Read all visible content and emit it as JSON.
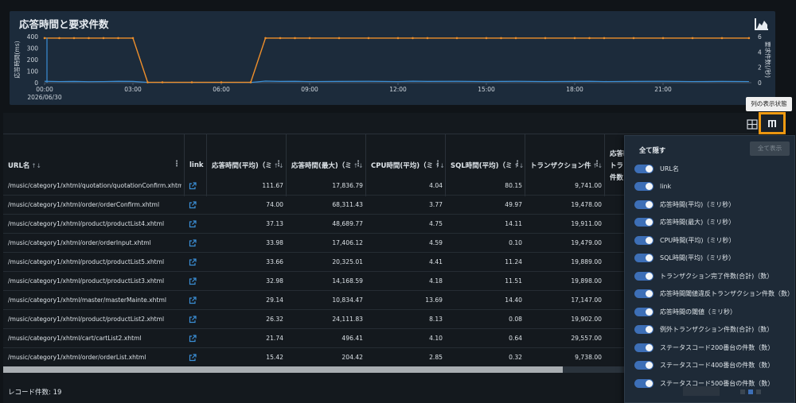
{
  "chart": {
    "title": "応答時間と要求件数",
    "icon": "area-chart-icon",
    "ylabel_left": "応答時間(ms)",
    "ylabel_right": "要求件数(/秒)",
    "y_left_ticks": [
      "400",
      "300",
      "200",
      "100",
      "0"
    ],
    "y_right_ticks": [
      "6",
      "4",
      "2",
      "0"
    ],
    "x_ticks": [
      "00:00",
      "03:00",
      "06:00",
      "09:00",
      "12:00",
      "15:00",
      "18:00",
      "21:00"
    ],
    "x_date": "2026/06/30",
    "colors": {
      "response": "#3b8fd6",
      "requests": "#ef8f2b"
    }
  },
  "chart_data": {
    "type": "line",
    "x": [
      "00:00",
      "00:30",
      "01:00",
      "01:30",
      "02:00",
      "02:30",
      "03:00",
      "03:30",
      "04:00",
      "05:00",
      "06:00",
      "07:00",
      "07:30",
      "08:00",
      "08:30",
      "09:00",
      "10:00",
      "11:00",
      "12:00",
      "12:30",
      "13:00",
      "14:00",
      "15:00",
      "15:30",
      "16:00",
      "17:00",
      "18:00",
      "18:30",
      "19:00",
      "20:00",
      "21:00",
      "22:00",
      "23:00",
      "23:55"
    ],
    "series": [
      {
        "values": [
          12,
          10,
          11,
          9,
          10,
          12,
          11,
          3,
          2,
          2,
          2,
          2,
          14,
          11,
          12,
          10,
          11,
          12,
          10,
          13,
          11,
          12,
          10,
          11,
          12,
          10,
          11,
          12,
          10,
          11,
          12,
          10,
          11,
          10
        ]
      },
      {
        "values": [
          5.8,
          5.8,
          5.8,
          5.8,
          5.8,
          5.8,
          5.8,
          0.05,
          0.05,
          0.05,
          0.05,
          0.05,
          5.8,
          5.8,
          5.8,
          5.8,
          5.8,
          5.8,
          5.8,
          5.8,
          5.8,
          5.8,
          5.8,
          5.8,
          5.8,
          5.8,
          5.8,
          5.8,
          5.8,
          5.8,
          5.8,
          5.8,
          5.8,
          5.8
        ]
      }
    ],
    "ylim_left": [
      0,
      400
    ],
    "ylim_right": [
      0,
      6
    ],
    "xlim": [
      "00:00",
      "24:00"
    ]
  },
  "grid": {
    "columns": [
      {
        "label": "URL名",
        "sort": "↑↓"
      },
      {
        "label": "link",
        "sort": ""
      },
      {
        "label": "応答時間(平均)（ミ",
        "sort": "↑↓"
      },
      {
        "label": "応答時間(最大)（ミ",
        "sort": "↑↓"
      },
      {
        "label": "CPU時間(平均)（ミ",
        "sort": "↑↓"
      },
      {
        "label": "SQL時間(平均)（ミ",
        "sort": "↑↓"
      },
      {
        "label": "トランザクション件",
        "sort": "↑↓"
      },
      {
        "label": "応答時",
        "sort": ""
      }
    ],
    "extra_header": [
      "トラ",
      "件数"
    ],
    "rows": [
      {
        "url": "/music/category1/xhtml/quotation/quotationConfirm.xhtml",
        "avg": "111.67",
        "max": "17,836.79",
        "cpu": "4.04",
        "sql": "80.15",
        "tx": "9,741.00"
      },
      {
        "url": "/music/category1/xhtml/order/orderConfirm.xhtml",
        "avg": "74.00",
        "max": "68,311.43",
        "cpu": "3.77",
        "sql": "49.97",
        "tx": "19,478.00"
      },
      {
        "url": "/music/category1/xhtml/product/productList4.xhtml",
        "avg": "37.13",
        "max": "48,689.77",
        "cpu": "4.75",
        "sql": "14.11",
        "tx": "19,911.00"
      },
      {
        "url": "/music/category1/xhtml/order/orderInput.xhtml",
        "avg": "33.98",
        "max": "17,406.12",
        "cpu": "4.59",
        "sql": "0.10",
        "tx": "19,479.00"
      },
      {
        "url": "/music/category1/xhtml/product/productList5.xhtml",
        "avg": "33.66",
        "max": "20,325.01",
        "cpu": "4.41",
        "sql": "11.24",
        "tx": "19,889.00"
      },
      {
        "url": "/music/category1/xhtml/product/productList3.xhtml",
        "avg": "32.98",
        "max": "14,168.59",
        "cpu": "4.18",
        "sql": "11.51",
        "tx": "19,898.00"
      },
      {
        "url": "/music/category1/xhtml/master/masterMainte.xhtml",
        "avg": "29.14",
        "max": "10,834.47",
        "cpu": "13.69",
        "sql": "14.40",
        "tx": "17,147.00"
      },
      {
        "url": "/music/category1/xhtml/product/productList2.xhtml",
        "avg": "26.32",
        "max": "24,111.83",
        "cpu": "8.13",
        "sql": "0.08",
        "tx": "19,902.00"
      },
      {
        "url": "/music/category1/xhtml/cart/cartList2.xhtml",
        "avg": "21.74",
        "max": "496.41",
        "cpu": "4.10",
        "sql": "0.64",
        "tx": "29,557.00"
      },
      {
        "url": "/music/category1/xhtml/order/orderList.xhtml",
        "avg": "15.42",
        "max": "204.42",
        "cpu": "2.85",
        "sql": "0.32",
        "tx": "9,738.00"
      }
    ],
    "record_count": "レコード件数: 19"
  },
  "toolbar": {
    "tooltip": "列の表示状態"
  },
  "column_panel": {
    "hide_all": "全て隠す",
    "show_all": "全て表示",
    "items": [
      "URL名",
      "link",
      "応答時間(平均)（ミリ秒）",
      "応答時間(最大)（ミリ秒）",
      "CPU時間(平均)（ミリ秒）",
      "SQL時間(平均)（ミリ秒）",
      "トランザクション完了件数(合計)（数）",
      "応答時間閾値違反トランザクション件数（数）",
      "応答時間の閾値（ミリ秒）",
      "例外トランザクション件数(合計)（数）",
      "ステータスコード200番台の件数（数）",
      "ステータスコード400番台の件数（数）",
      "ステータスコード500番台の件数（数）"
    ]
  }
}
